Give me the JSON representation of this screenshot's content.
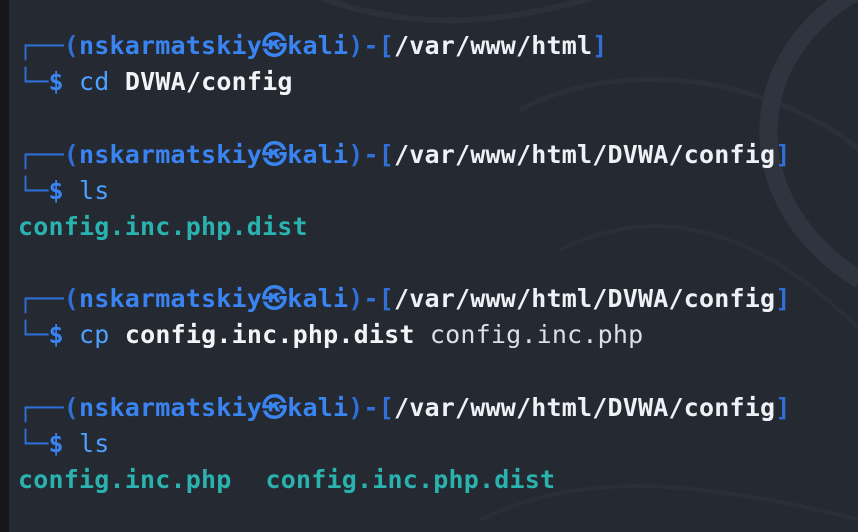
{
  "window": {
    "type": "terminal"
  },
  "colors": {
    "background": "#252932",
    "prompt_box": "#2f6fd6",
    "prompt_user": "#3a84f2",
    "path": "#eef1f5",
    "command": "#4ea0ff",
    "output": "#2ab3ae"
  },
  "prompt": {
    "open": "┌──(",
    "user": "nskarmatskiy",
    "at_symbol": "㉿",
    "host": "kali",
    "mid": ")-[",
    "close": "]",
    "second_line": "└─",
    "dollar": "$"
  },
  "entries": [
    {
      "path": "/var/www/html",
      "command": "cd",
      "args": "DVWA/config",
      "args2": "",
      "output": []
    },
    {
      "path": "/var/www/html/DVWA/config",
      "command": "ls",
      "args": "",
      "args2": "",
      "output": [
        "config.inc.php.dist"
      ]
    },
    {
      "path": "/var/www/html/DVWA/config",
      "command": "cp",
      "args": "config.inc.php.dist",
      "args2": "config.inc.php",
      "output": []
    },
    {
      "path": "/var/www/html/DVWA/config",
      "command": "ls",
      "args": "",
      "args2": "",
      "output": [
        "config.inc.php",
        "config.inc.php.dist"
      ]
    }
  ]
}
